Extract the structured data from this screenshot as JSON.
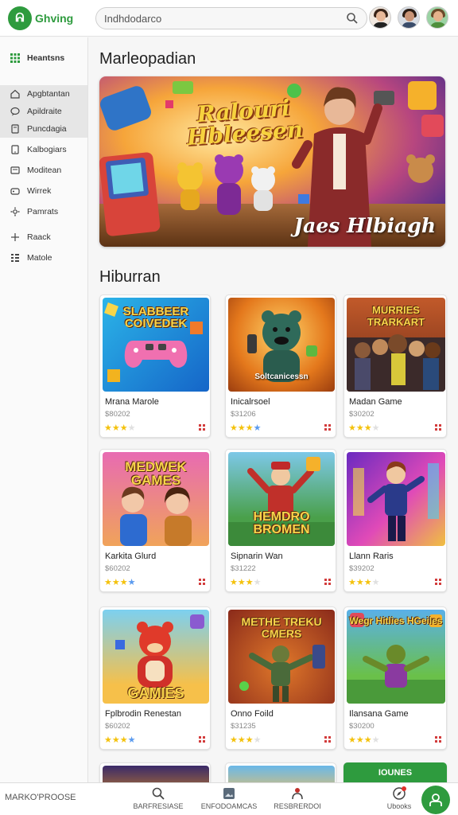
{
  "app": {
    "logo_mark": "ᕱ",
    "logo_text": "Ghving"
  },
  "search": {
    "value": "Indhdodarco"
  },
  "sidebar": {
    "header": "Heantsns",
    "items": [
      {
        "label": "Apgbtantan",
        "icon": "home-icon"
      },
      {
        "label": "Apildraite",
        "icon": "chat-icon"
      },
      {
        "label": "Puncdagia",
        "icon": "doc-icon"
      },
      {
        "label": "Kalbogiars",
        "icon": "tablet-icon"
      },
      {
        "label": "Moditean",
        "icon": "card-icon"
      },
      {
        "label": "Wirrek",
        "icon": "gamepad-icon"
      },
      {
        "label": "Pamrats",
        "icon": "gear-icon"
      },
      {
        "label": "Raack",
        "icon": "arrows-icon"
      },
      {
        "label": "Matole",
        "icon": "list-icon"
      }
    ]
  },
  "featured": {
    "title": "Marleopadian",
    "hero_title": "Ralouri Hbleesen",
    "hero_caption": "Jaes Hlbiagh"
  },
  "catalog": {
    "title": "Hiburran",
    "cards": [
      {
        "name": "Mrana Marole",
        "price": "$80202",
        "rating": 3,
        "thumb_text": "SLABBEER COIVEDEK"
      },
      {
        "name": "Inicalrsoel",
        "price": "$31206",
        "rating": 4,
        "thumb_text": "Soltcanicessn"
      },
      {
        "name": "Madan Game",
        "price": "$30202",
        "rating": 3,
        "thumb_text": "MURRIES TRARKART"
      },
      {
        "name": "Karkita Glurd",
        "price": "$60202",
        "rating": 4,
        "thumb_text": "MEDWEK GAMES"
      },
      {
        "name": "Sipnarin Wan",
        "price": "$31222",
        "rating": 3,
        "thumb_text": "HEMDRO BROMEN"
      },
      {
        "name": "Llann Raris",
        "price": "$39202",
        "rating": 3,
        "thumb_text": ""
      },
      {
        "name": "Fplbrodin Renestan",
        "price": "$60202",
        "rating": 4,
        "thumb_text": "GAMIES"
      },
      {
        "name": "Onno Foild",
        "price": "$31235",
        "rating": 3,
        "thumb_text": "METHE TREKU CMERS"
      },
      {
        "name": "Ilansana Game",
        "price": "$30200",
        "rating": 3,
        "thumb_text": "Wegr Hitlies HGeiles"
      }
    ],
    "partial_card_label": "IOUNES"
  },
  "bottom_nav": {
    "left_label": "MARKO'PROOSE",
    "tabs": [
      {
        "label": "BARFRESIASE",
        "icon": "search-icon"
      },
      {
        "label": "ENFODOAMCAS",
        "icon": "image-icon"
      },
      {
        "label": "RESBRERDOI",
        "icon": "person-icon"
      },
      {
        "label": "Ubooks",
        "icon": "compass-icon"
      }
    ]
  },
  "colors": {
    "brand": "#2e9b3e",
    "star": "#f4c20d",
    "star_alt": "#5b9bef"
  }
}
